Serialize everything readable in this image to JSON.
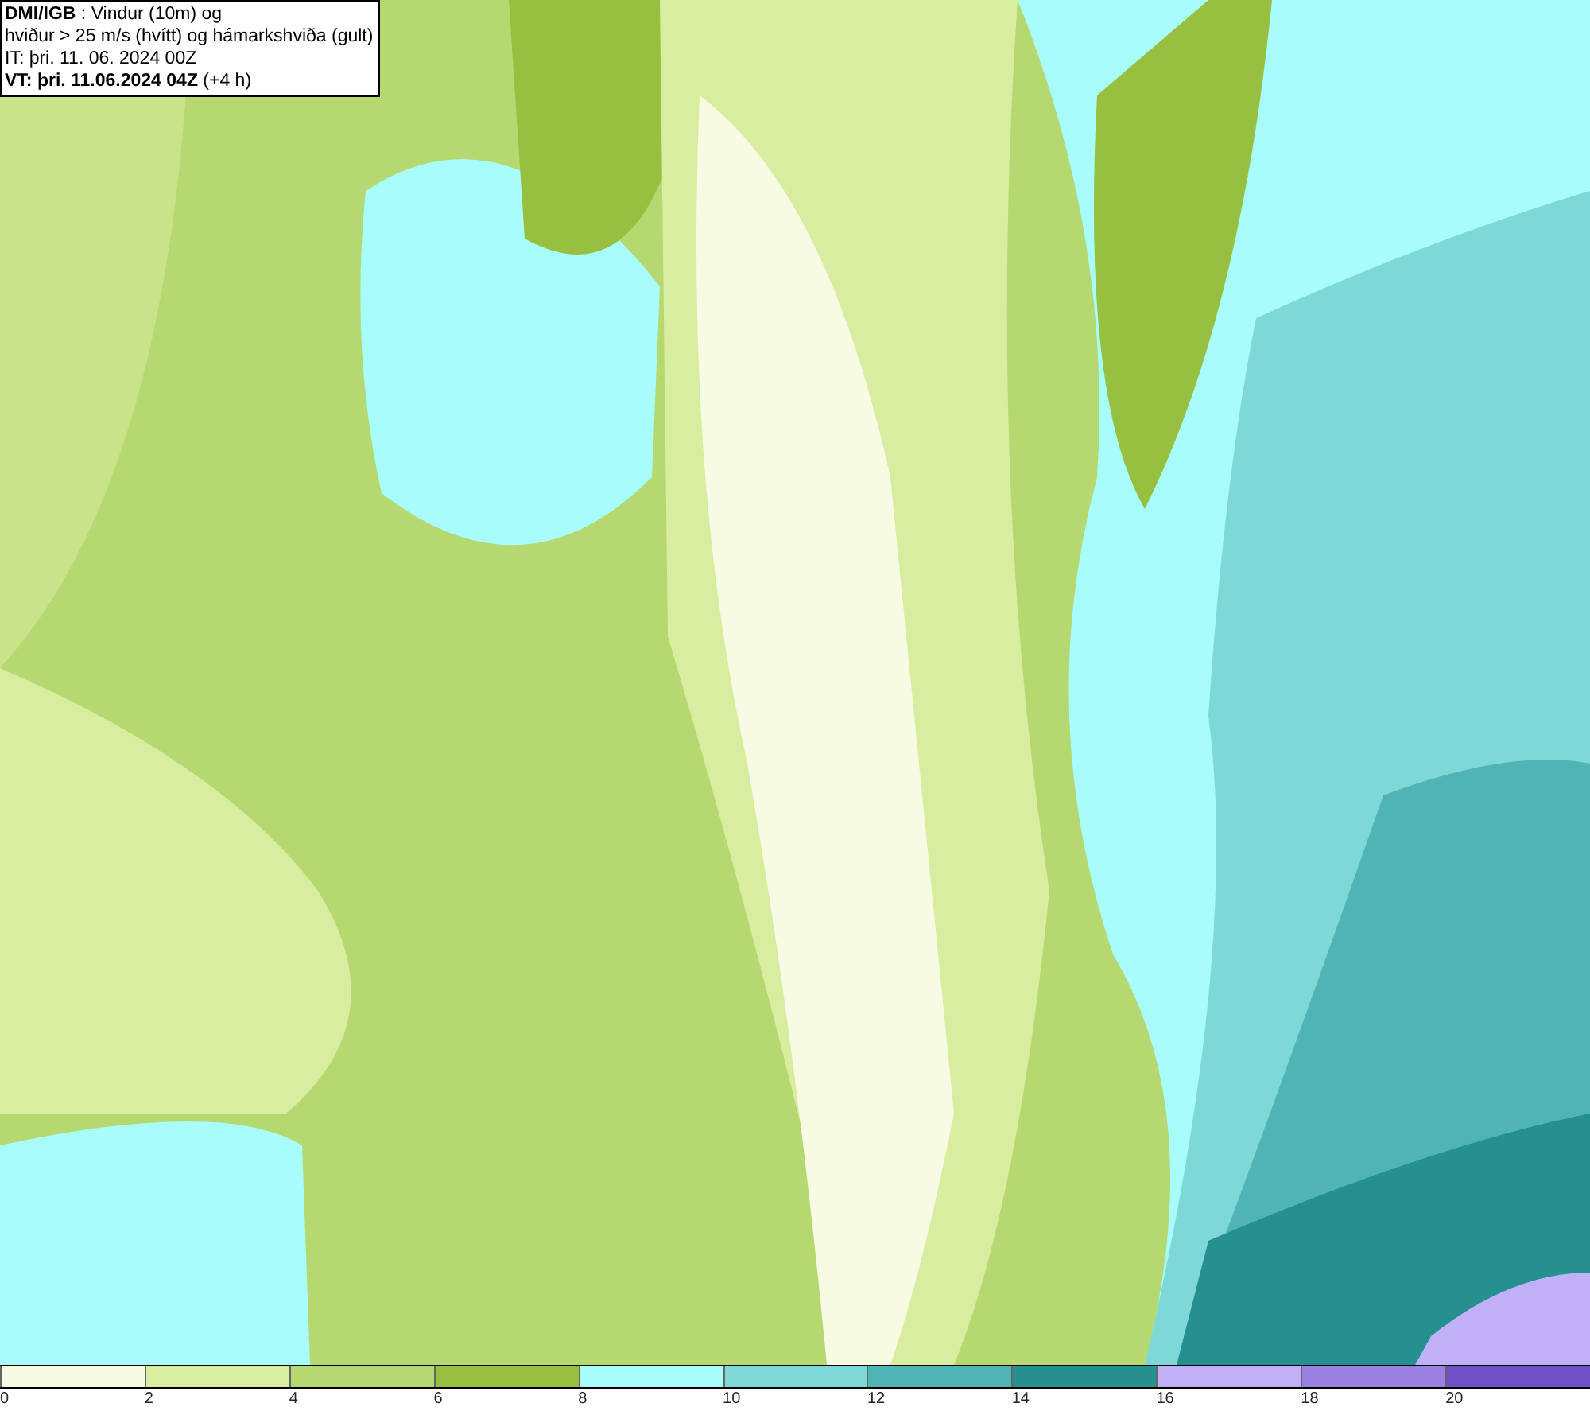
{
  "title_box": {
    "lines": [
      "**DMI/IGB** : Vindur (10m) og",
      "hviður > 25 m/s (hvítt) og hámarkshviða (gult)",
      "IT: þri. 11. 06. 2024 00Z",
      "**VT: þri. 11.06.2024 04Z** (+4 h)"
    ]
  },
  "legend": {
    "segments": [
      {
        "color": "#f7fbe4"
      },
      {
        "color": "#d8eda0"
      },
      {
        "color": "#b5d870"
      },
      {
        "color": "#98c040"
      },
      {
        "color": "#a8fcfc"
      },
      {
        "color": "#7ed8d8"
      },
      {
        "color": "#50b4b4"
      },
      {
        "color": "#269090"
      },
      {
        "color": "#c0b0f8"
      },
      {
        "color": "#9a80e0"
      },
      {
        "color": "#7050c8"
      }
    ],
    "ticks": [
      "0",
      "2",
      "4",
      "6",
      "8",
      "10",
      "12",
      "14",
      "16",
      "18",
      "20"
    ]
  }
}
